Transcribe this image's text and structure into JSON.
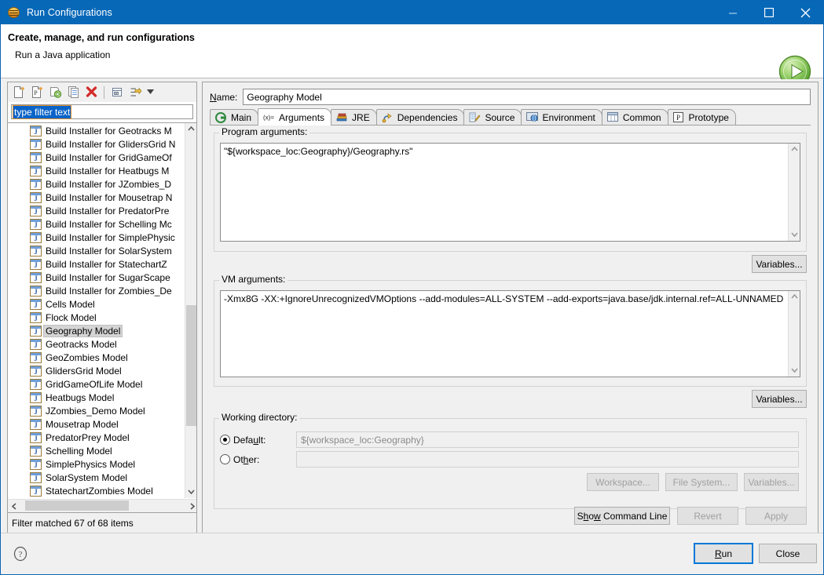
{
  "window": {
    "title": "Run Configurations",
    "icon": "run-configurations-icon",
    "minimize_label": "Minimize",
    "maximize_label": "Maximize",
    "close_label": "Close"
  },
  "header": {
    "title": "Create, manage, and run configurations",
    "subtitle": "Run a Java application",
    "run_icon": "green-run-play-icon"
  },
  "left": {
    "toolbar": [
      {
        "name": "new-configuration-icon",
        "tooltip": "New launch configuration"
      },
      {
        "name": "new-prototype-icon",
        "tooltip": "New prototype"
      },
      {
        "name": "export-icon",
        "tooltip": "Export"
      },
      {
        "name": "duplicate-icon",
        "tooltip": "Duplicate"
      },
      {
        "name": "delete-icon",
        "tooltip": "Delete"
      },
      {
        "name": "collapse-all-icon",
        "tooltip": "Collapse All"
      },
      {
        "name": "filter-icon",
        "tooltip": "Filter launch configurations"
      },
      {
        "name": "chevron-down-icon",
        "tooltip": "View Menu"
      }
    ],
    "filter": {
      "value": "type filter text",
      "placeholder": "type filter text"
    },
    "tree_items": [
      {
        "label": "Build Installer for Geotracks M",
        "selected": false
      },
      {
        "label": "Build Installer for GlidersGrid N",
        "selected": false
      },
      {
        "label": "Build Installer for GridGameOf",
        "selected": false
      },
      {
        "label": "Build Installer for Heatbugs M",
        "selected": false
      },
      {
        "label": "Build Installer for JZombies_D",
        "selected": false
      },
      {
        "label": "Build Installer for Mousetrap N",
        "selected": false
      },
      {
        "label": "Build Installer for PredatorPre",
        "selected": false
      },
      {
        "label": "Build Installer for Schelling Mc",
        "selected": false
      },
      {
        "label": "Build Installer for SimplePhysic",
        "selected": false
      },
      {
        "label": "Build Installer for SolarSystem",
        "selected": false
      },
      {
        "label": "Build Installer for StatechartZ",
        "selected": false
      },
      {
        "label": "Build Installer for SugarScape",
        "selected": false
      },
      {
        "label": "Build Installer for Zombies_De",
        "selected": false
      },
      {
        "label": "Cells Model",
        "selected": false
      },
      {
        "label": "Flock Model",
        "selected": false
      },
      {
        "label": "Geography Model",
        "selected": true
      },
      {
        "label": "Geotracks Model",
        "selected": false
      },
      {
        "label": "GeoZombies Model",
        "selected": false
      },
      {
        "label": "GlidersGrid Model",
        "selected": false
      },
      {
        "label": "GridGameOfLife Model",
        "selected": false
      },
      {
        "label": "Heatbugs Model",
        "selected": false
      },
      {
        "label": "JZombies_Demo Model",
        "selected": false
      },
      {
        "label": "Mousetrap Model",
        "selected": false
      },
      {
        "label": "PredatorPrey Model",
        "selected": false
      },
      {
        "label": "Schelling Model",
        "selected": false
      },
      {
        "label": "SimplePhysics Model",
        "selected": false
      },
      {
        "label": "SolarSystem Model",
        "selected": false
      },
      {
        "label": "StatechartZombies Model",
        "selected": false
      }
    ],
    "status": "Filter matched 67 of 68 items"
  },
  "right": {
    "name_label": "Name:",
    "name_value": "Geography Model",
    "tabs": [
      {
        "label": "Main",
        "icon": "main-tab-icon",
        "active": false
      },
      {
        "label": "Arguments",
        "icon": "arguments-tab-icon",
        "active": true
      },
      {
        "label": "JRE",
        "icon": "jre-tab-icon",
        "active": false
      },
      {
        "label": "Dependencies",
        "icon": "dependencies-tab-icon",
        "active": false
      },
      {
        "label": "Source",
        "icon": "source-tab-icon",
        "active": false
      },
      {
        "label": "Environment",
        "icon": "environment-tab-icon",
        "active": false
      },
      {
        "label": "Common",
        "icon": "common-tab-icon",
        "active": false
      },
      {
        "label": "Prototype",
        "icon": "prototype-tab-icon",
        "active": false
      }
    ],
    "program_args": {
      "label": "Program arguments:",
      "value": "\"${workspace_loc:Geography}/Geography.rs\"",
      "variables_button": "Variables..."
    },
    "vm_args": {
      "label": "VM arguments:",
      "value": "-Xmx8G -XX:+IgnoreUnrecognizedVMOptions --add-modules=ALL-SYSTEM --add-exports=java.base/jdk.internal.ref=ALL-UNNAMED",
      "variables_button": "Variables..."
    },
    "working_dir": {
      "label": "Working directory:",
      "default_label": "Default:",
      "default_value": "${workspace_loc:Geography}",
      "other_label": "Other:",
      "other_value": "",
      "default_selected": true,
      "workspace_button": "Workspace...",
      "filesystem_button": "File System...",
      "variables_button": "Variables..."
    },
    "actions": {
      "show_command_line": "Show Command Line",
      "revert": "Revert",
      "apply": "Apply"
    }
  },
  "footer": {
    "help_icon": "help-question-icon",
    "run_button": "Run",
    "close_button": "Close"
  },
  "colors": {
    "title_bar": "#0768b8",
    "selection": "#0a64c8",
    "accent": "#0078d7",
    "run_green": "#6cbe45"
  }
}
